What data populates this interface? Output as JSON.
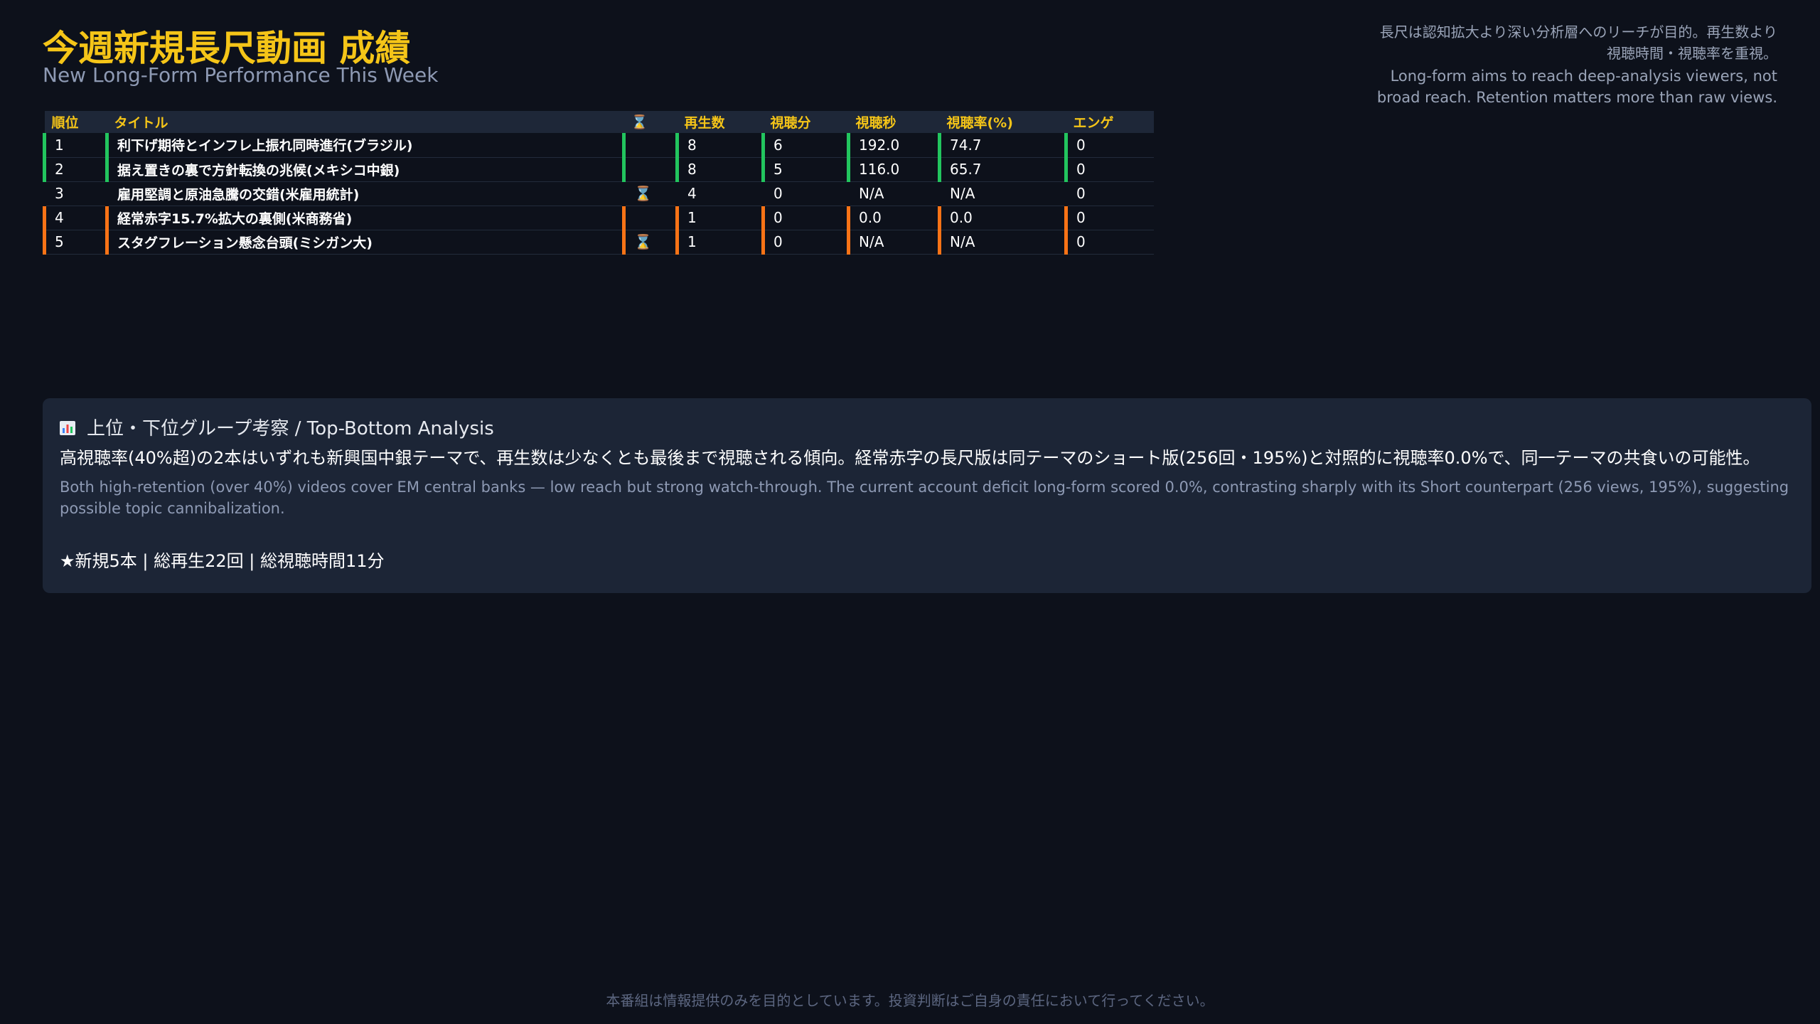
{
  "header": {
    "title_ja": "今週新規長尺動画 成績",
    "title_en": "New Long-Form Performance This Week",
    "note_ja_1": "長尺は認知拡大より深い分析層へのリーチが目的。再生数より",
    "note_ja_2": "視聴時間・視聴率を重視。",
    "note_en_1": "Long-form aims to reach deep-analysis viewers, not",
    "note_en_2": "broad reach. Retention matters more than raw views."
  },
  "table": {
    "columns": [
      "順位",
      "タイトル",
      "⌛",
      "再生数",
      "視聴分",
      "視聴秒",
      "視聴率(%)",
      "エンゲ"
    ],
    "rows": [
      {
        "rank": "1",
        "title": "利下げ期待とインフレ上振れ同時進行(ブラジル)",
        "status": "",
        "views": "8",
        "minutes": "6",
        "seconds": "192.0",
        "rate": "74.7",
        "eng": "0"
      },
      {
        "rank": "2",
        "title": "据え置きの裏で方針転換の兆候(メキシコ中銀)",
        "status": "",
        "views": "8",
        "minutes": "5",
        "seconds": "116.0",
        "rate": "65.7",
        "eng": "0"
      },
      {
        "rank": "3",
        "title": "雇用堅調と原油急騰の交錯(米雇用統計)",
        "status": "⌛",
        "views": "4",
        "minutes": "0",
        "seconds": "N/A",
        "rate": "N/A",
        "eng": "0"
      },
      {
        "rank": "4",
        "title": "経常赤字15.7%拡大の裏側(米商務省)",
        "status": "",
        "views": "1",
        "minutes": "0",
        "seconds": "0.0",
        "rate": "0.0",
        "eng": "0"
      },
      {
        "rank": "5",
        "title": "スタグフレーション懸念台頭(ミシガン大)",
        "status": "⌛",
        "views": "1",
        "minutes": "0",
        "seconds": "N/A",
        "rate": "N/A",
        "eng": "0"
      }
    ]
  },
  "analysis": {
    "icon": "bar-chart-icon",
    "heading": "上位・下位グループ考察 / Top-Bottom Analysis",
    "body_ja": "高視聴率(40%超)の2本はいずれも新興国中銀テーマで、再生数は少なくとも最後まで視聴される傾向。経常赤字の長尺版は同テーマのショート版(256回・195%)と対照的に視聴率0.0%で、同一テーマの共食いの可能性。",
    "body_en": "Both high-retention (over 40%) videos cover EM central banks — low reach but strong watch-through. The current account deficit long-form scored 0.0%, contrasting sharply with its Short counterpart (256 views, 195%), suggesting possible topic cannibalization.",
    "summary": "★新規5本 | 総再生22回 | 総視聴時間11分"
  },
  "footer": {
    "disclaimer": "本番組は情報提供のみを目的としています。投資判断はご自身の責任において行ってください。"
  },
  "colors": {
    "accent": "#f5c518",
    "good": "#22c55e",
    "bad": "#f97316",
    "background": "#0d111b",
    "card": "#1c2536"
  }
}
